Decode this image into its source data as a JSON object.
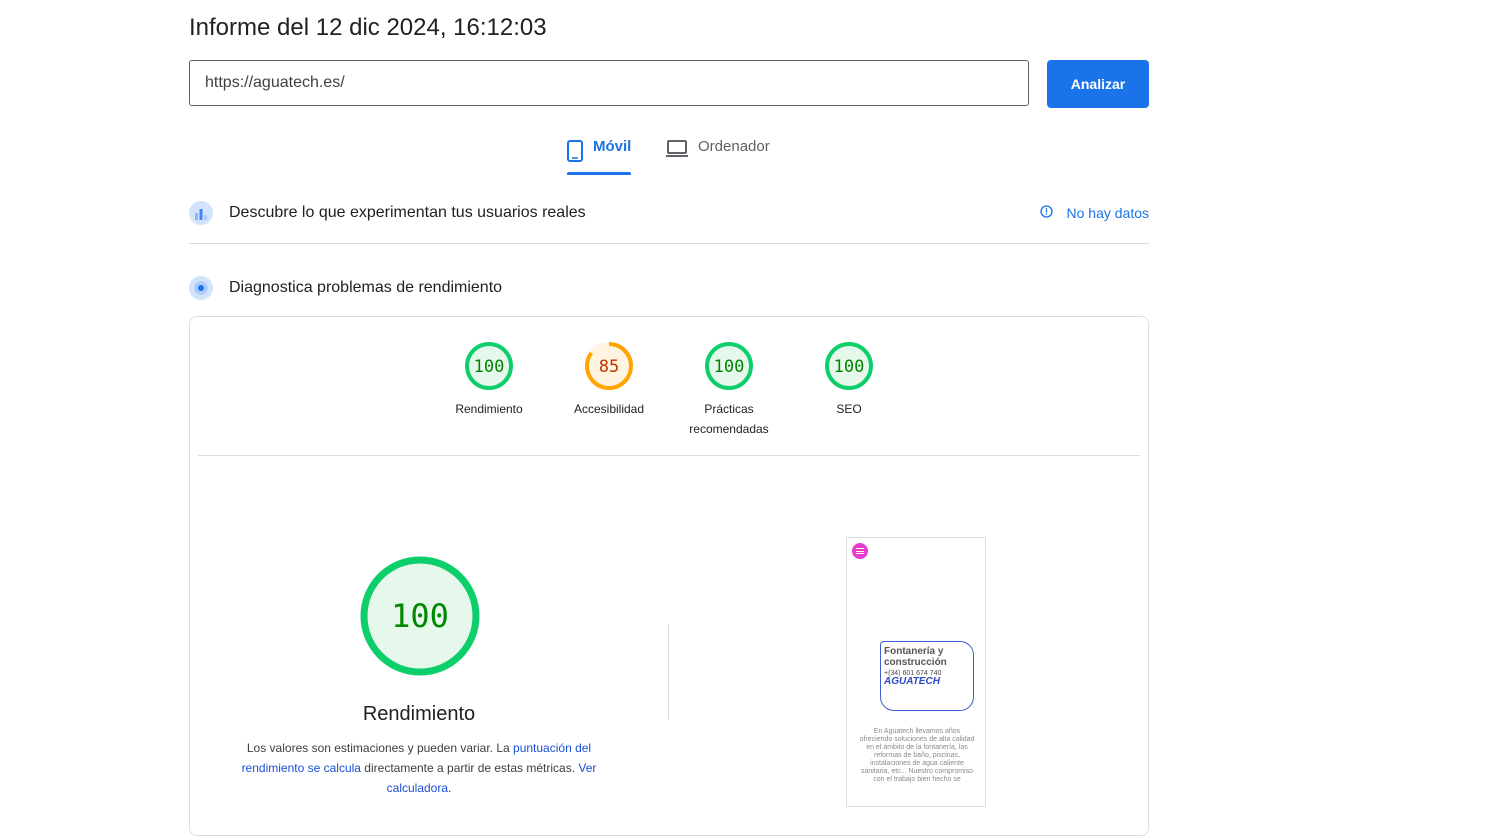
{
  "header": {
    "title": "Informe del 12 dic 2024, 16:12:03"
  },
  "search": {
    "url": "https://aguatech.es/",
    "analyze_label": "Analizar"
  },
  "tabs": [
    {
      "label": "Móvil",
      "icon": "smartphone-icon",
      "active": true
    },
    {
      "label": "Ordenador",
      "icon": "laptop-icon",
      "active": false
    }
  ],
  "real_users": {
    "title": "Descubre lo que experimentan tus usuarios reales",
    "status": "No hay datos",
    "icon": "users-chart-icon"
  },
  "diagnostics": {
    "title": "Diagnostica problemas de rendimiento",
    "icon": "lighthouse-icon"
  },
  "scores": [
    {
      "value": "100",
      "label": "Rendimiento",
      "status": "pass"
    },
    {
      "value": "85",
      "label": "Accesibilidad",
      "status": "average"
    },
    {
      "value": "100",
      "label": "Prácticas recomendadas",
      "status": "pass"
    },
    {
      "value": "100",
      "label": "SEO",
      "status": "pass"
    }
  ],
  "performance": {
    "score": "100",
    "title": "Rendimiento",
    "desc_prefix": "Los valores son estimaciones y pueden variar. La ",
    "desc_link1": "puntuación del rendimiento se calcula",
    "desc_middle": " directamente a partir de estas métricas. ",
    "desc_link2": "Ver calculadora",
    "desc_suffix": "."
  },
  "screenshot": {
    "heading": "Fontanería y construcción",
    "phone": "+(34) 601 674 740",
    "logo": "AGUATECH",
    "body": "En Aguatech llevamos años ofreciendo soluciones de alta calidad en el ámbito de la fontanería, las reformas de baño, piscinas, instalaciones de agua caliente sanitaria, etc... Nuestro compromiso con el trabajo bien hecho se"
  },
  "colors": {
    "accent": "#1a73e8",
    "pass": "#0cce6b",
    "pass_text": "#008800",
    "average": "#ffa400",
    "average_text": "#c33300"
  }
}
